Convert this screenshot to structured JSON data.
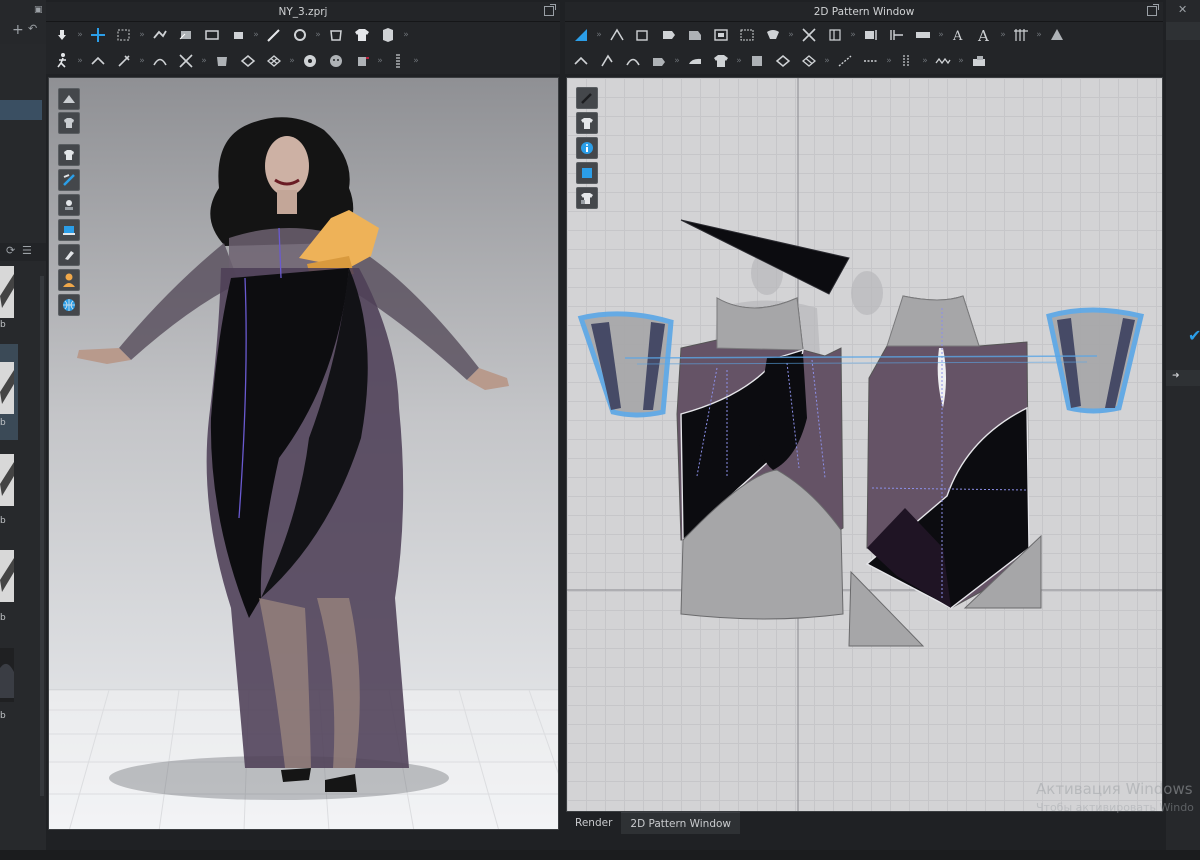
{
  "window_3d": {
    "title": "NY_3.zprj"
  },
  "window_2d": {
    "title": "2D Pattern Window"
  },
  "bottom_tabs": [
    {
      "label": "Render",
      "active": false
    },
    {
      "label": "2D Pattern Window",
      "active": true
    }
  ],
  "left_library": {
    "thumbnail_labels": [
      "b",
      "b",
      "b",
      "b",
      "b"
    ]
  },
  "right_panel": {
    "checked": true
  },
  "watermark": {
    "line1": "Активация Windows",
    "line2": "Чтобы активировать Windo"
  },
  "colors": {
    "accent": "#2b9ee8",
    "viewport_3d_top": "#8f9094",
    "viewport_3d_bottom": "#eceef1",
    "pattern_bg": "#d3d3d5",
    "fabric_dark": "#0c0c10",
    "fabric_purple": "#655366",
    "fabric_grey": "#a6a6a8",
    "sleeve_outline": "#5aa6e6",
    "bow": "#eeb258",
    "watermark": "#a0a4a8"
  },
  "icons": {
    "toolbar_3d_row1": [
      "hand-icon",
      "transform-icon",
      "select-box-icon",
      "move-icon",
      "edit-pin-icon",
      "fold-icon",
      "tack-icon",
      "needle-icon",
      "arrange-icon",
      "garment-icon",
      "shirt-icon",
      "ruler-icon"
    ],
    "toolbar_3d_row2": [
      "avatar-walk-icon",
      "select-mesh-icon",
      "pin-icon",
      "seam-icon",
      "cut-icon",
      "fold-arrange-icon",
      "texture-icon",
      "grid-icon",
      "button-icon",
      "stitch-icon",
      "zipper-icon"
    ],
    "toolbar_2d_row1": [
      "transform-pattern-icon",
      "edit-point-icon",
      "polygon-icon",
      "rectangle-icon",
      "internal-polygon-icon",
      "internal-rect-icon",
      "dart-icon",
      "segment-sewing-icon",
      "free-sewing-icon",
      "fold-icon",
      "notch-icon",
      "measure-icon",
      "text-icon",
      "annotation-icon",
      "grid-pattern-icon",
      "fabric-icon"
    ],
    "toolbar_2d_row2": [
      "edit-sewing-icon",
      "add-point-icon",
      "fold-pattern-icon",
      "seam-tape-icon",
      "iron-icon",
      "shirt-icon",
      "texture-icon",
      "grid-icon",
      "pattern-pin-icon",
      "topstitch-icon",
      "dash-line-icon",
      "puckering-icon",
      "zigzag-icon",
      "fabric-swatch-icon"
    ],
    "viewport_3d_side": [
      "avatar-display-icon",
      "garment-display-icon",
      "show-avatar-icon",
      "show-texture-icon",
      "visibility-icon",
      "surface-icon",
      "fit-map-icon",
      "avatar-icon",
      "globe-icon"
    ],
    "viewport_2d_side": [
      "edit-pen-icon",
      "shirt-view-icon",
      "info-icon",
      "texture-view-icon",
      "lock-icon"
    ]
  }
}
